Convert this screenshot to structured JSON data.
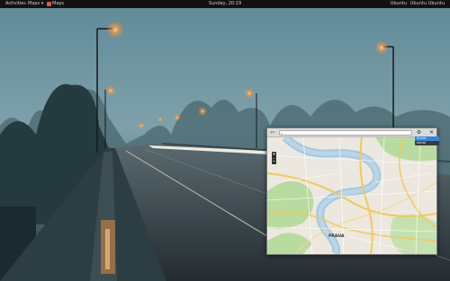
{
  "topbar": {
    "activities": "Activities",
    "app_menu": "Maps",
    "maps_app": "Maps",
    "clock": "Sunday, 20:19",
    "tray": [
      "Ubuntu",
      "Ubuntu",
      "Ubuntu"
    ]
  },
  "maps": {
    "search_placeholder": "",
    "back_icon": "back-arrow-icon",
    "gear_icon": "gear-icon",
    "close_icon": "close-icon",
    "zoom_in": "+",
    "zoom_out": "−",
    "city_label": "PRAHA",
    "layers": [
      "Street",
      "Aerial"
    ]
  },
  "colors": {
    "topbar": "#121212",
    "accent": "#3584e4",
    "map_water": "#a5c8e1",
    "map_park": "#b8dba0",
    "map_road": "#f1c85a"
  }
}
